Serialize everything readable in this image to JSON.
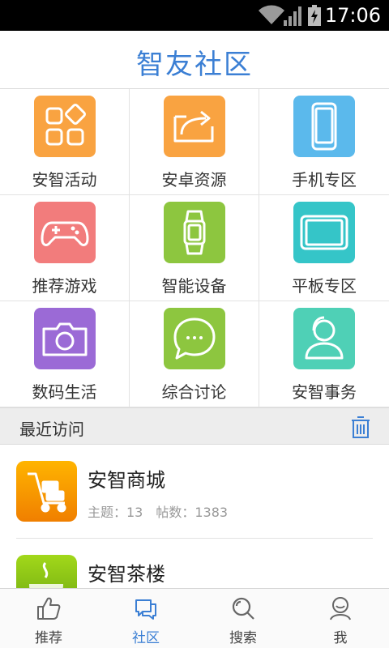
{
  "status_bar": {
    "time": "17:06"
  },
  "header": {
    "title": "智友社区"
  },
  "grid": {
    "items": [
      {
        "label": "安智活动",
        "icon": "apps-icon",
        "color": "#f9a341"
      },
      {
        "label": "安卓资源",
        "icon": "share-icon",
        "color": "#f9a341"
      },
      {
        "label": "手机专区",
        "icon": "phone-icon",
        "color": "#5bb9ec"
      },
      {
        "label": "推荐游戏",
        "icon": "gamepad-icon",
        "color": "#f27c7c"
      },
      {
        "label": "智能设备",
        "icon": "smartwatch-icon",
        "color": "#8dc63f"
      },
      {
        "label": "平板专区",
        "icon": "tablet-icon",
        "color": "#35c5c8"
      },
      {
        "label": "数码生活",
        "icon": "camera-icon",
        "color": "#9b6ad6"
      },
      {
        "label": "综合讨论",
        "icon": "chat-bubble-icon",
        "color": "#8dc63f"
      },
      {
        "label": "安智事务",
        "icon": "support-agent-icon",
        "color": "#4fd0b6"
      }
    ]
  },
  "recent": {
    "title": "最近访问",
    "items": [
      {
        "name": "安智商城",
        "meta": "主题：13　帖数：1383",
        "icon": "cart-icon"
      },
      {
        "name": "安智茶楼",
        "meta": "",
        "icon": "teacup-icon"
      }
    ]
  },
  "bottom_nav": {
    "items": [
      {
        "label": "推荐",
        "icon": "thumbs-up-icon",
        "active": false
      },
      {
        "label": "社区",
        "icon": "chat-icon",
        "active": true
      },
      {
        "label": "搜索",
        "icon": "search-icon",
        "active": false
      },
      {
        "label": "我",
        "icon": "user-icon",
        "active": false
      }
    ]
  },
  "colors": {
    "accent": "#3b7fd4"
  }
}
